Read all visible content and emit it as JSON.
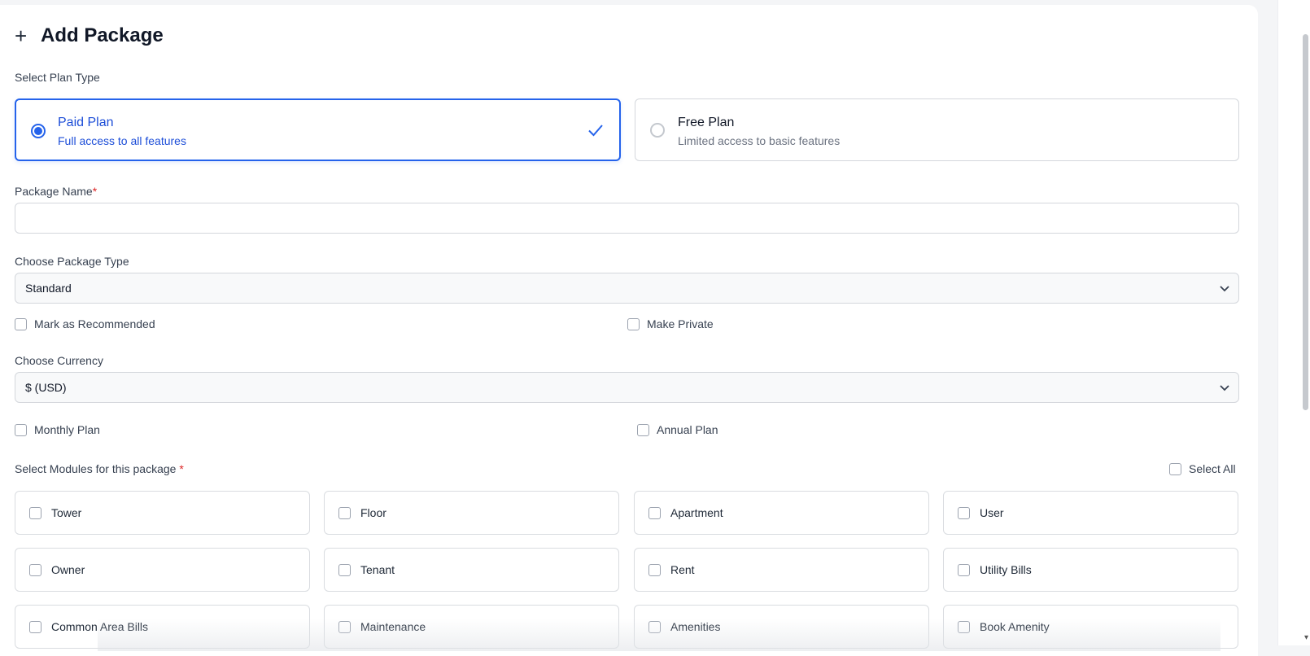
{
  "header": {
    "title": "Add Package",
    "plus_icon": "plus-icon"
  },
  "plan_type": {
    "label": "Select Plan Type",
    "options": [
      {
        "name": "Paid Plan",
        "description": "Full access to all features",
        "selected": true
      },
      {
        "name": "Free Plan",
        "description": "Limited access to basic features",
        "selected": false
      }
    ]
  },
  "package_name": {
    "label": "Package Name",
    "required_mark": "*",
    "value": "",
    "placeholder": ""
  },
  "package_type": {
    "label": "Choose Package Type",
    "value": "Standard"
  },
  "flags": {
    "recommended": "Mark as Recommended",
    "private": "Make Private"
  },
  "currency": {
    "label": "Choose Currency",
    "value": "$ (USD)"
  },
  "billing": {
    "monthly": "Monthly Plan",
    "annual": "Annual Plan"
  },
  "modules": {
    "label": "Select Modules for this package",
    "required_mark": "*",
    "select_all": "Select All",
    "items": [
      "Tower",
      "Floor",
      "Apartment",
      "User",
      "Owner",
      "Tenant",
      "Rent",
      "Utility Bills",
      "Common Area Bills",
      "Maintenance",
      "Amenities",
      "Book Amenity"
    ]
  },
  "colors": {
    "accent": "#2563eb",
    "required": "#dc2626",
    "border": "#d4d7dc"
  }
}
